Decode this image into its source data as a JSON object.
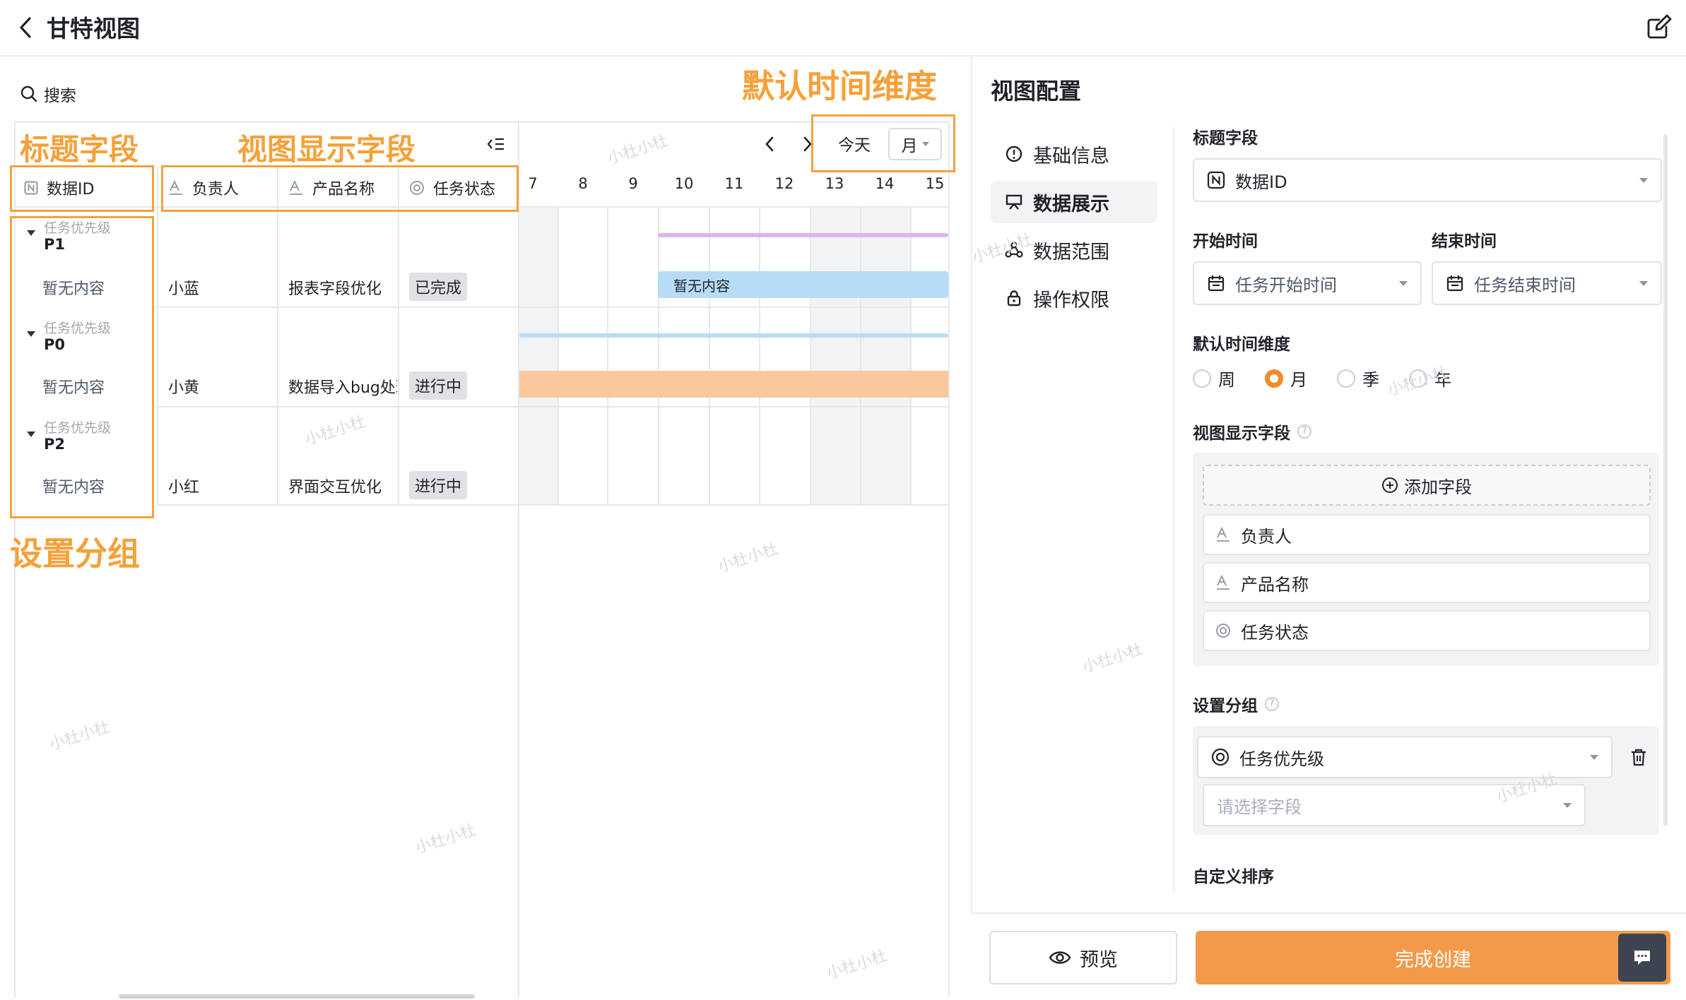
{
  "header": {
    "title": "甘特视图",
    "back_icon": "chevron-left-icon",
    "edit_icon": "edit-icon"
  },
  "toolbar": {
    "search_label": "搜索",
    "today_label": "今天",
    "scale_value": "月"
  },
  "annotations": {
    "default_time_scale": "默认时间维度",
    "title_field": "标题字段",
    "view_fields": "视图显示字段",
    "grouping": "设置分组"
  },
  "table": {
    "columns": [
      {
        "label": "数据ID",
        "icon": "number-field-icon"
      },
      {
        "label": "负责人",
        "icon": "text-field-icon"
      },
      {
        "label": "产品名称",
        "icon": "text-field-icon"
      },
      {
        "label": "任务状态",
        "icon": "status-field-icon"
      }
    ],
    "groups": [
      {
        "label": "任务优先级",
        "value": "P1",
        "row": {
          "title": "暂无内容",
          "owner": "小蓝",
          "product": "报表字段优化",
          "status": "已完成"
        }
      },
      {
        "label": "任务优先级",
        "value": "P0",
        "row": {
          "title": "暂无内容",
          "owner": "小黄",
          "product": "数据导入bug处理",
          "status": "进行中"
        }
      },
      {
        "label": "任务优先级",
        "value": "P2",
        "row": {
          "title": "暂无内容",
          "owner": "小红",
          "product": "界面交互优化",
          "status": "进行中"
        }
      }
    ]
  },
  "gantt": {
    "days": [
      "7",
      "8",
      "9",
      "10",
      "11",
      "12",
      "13",
      "14",
      "15"
    ],
    "bar_label": "暂无内容",
    "colors": {
      "purple": "#dcb4f2",
      "blue": "#b7dcf7",
      "orange": "#f7c99d",
      "accent": "#f5892e",
      "annot": "#f5a13a"
    }
  },
  "config": {
    "title": "视图配置",
    "nav": [
      {
        "label": "基础信息",
        "icon": "info-icon"
      },
      {
        "label": "数据展示",
        "icon": "display-icon"
      },
      {
        "label": "数据范围",
        "icon": "range-icon"
      },
      {
        "label": "操作权限",
        "icon": "lock-icon"
      }
    ],
    "title_field_label": "标题字段",
    "title_field_value": "数据ID",
    "start_label": "开始时间",
    "start_value": "任务开始时间",
    "end_label": "结束时间",
    "end_value": "任务结束时间",
    "scale_label": "默认时间维度",
    "scale_options": [
      "周",
      "月",
      "季",
      "年"
    ],
    "scale_selected": "月",
    "view_fields_label": "视图显示字段",
    "add_field_label": "添加字段",
    "view_fields": [
      "负责人",
      "产品名称",
      "任务状态"
    ],
    "grouping_label": "设置分组",
    "grouping_value": "任务优先级",
    "grouping_placeholder": "请选择字段",
    "sort_label": "自定义排序",
    "preview_label": "预览",
    "create_label": "完成创建"
  },
  "watermark": "小杜小杜"
}
